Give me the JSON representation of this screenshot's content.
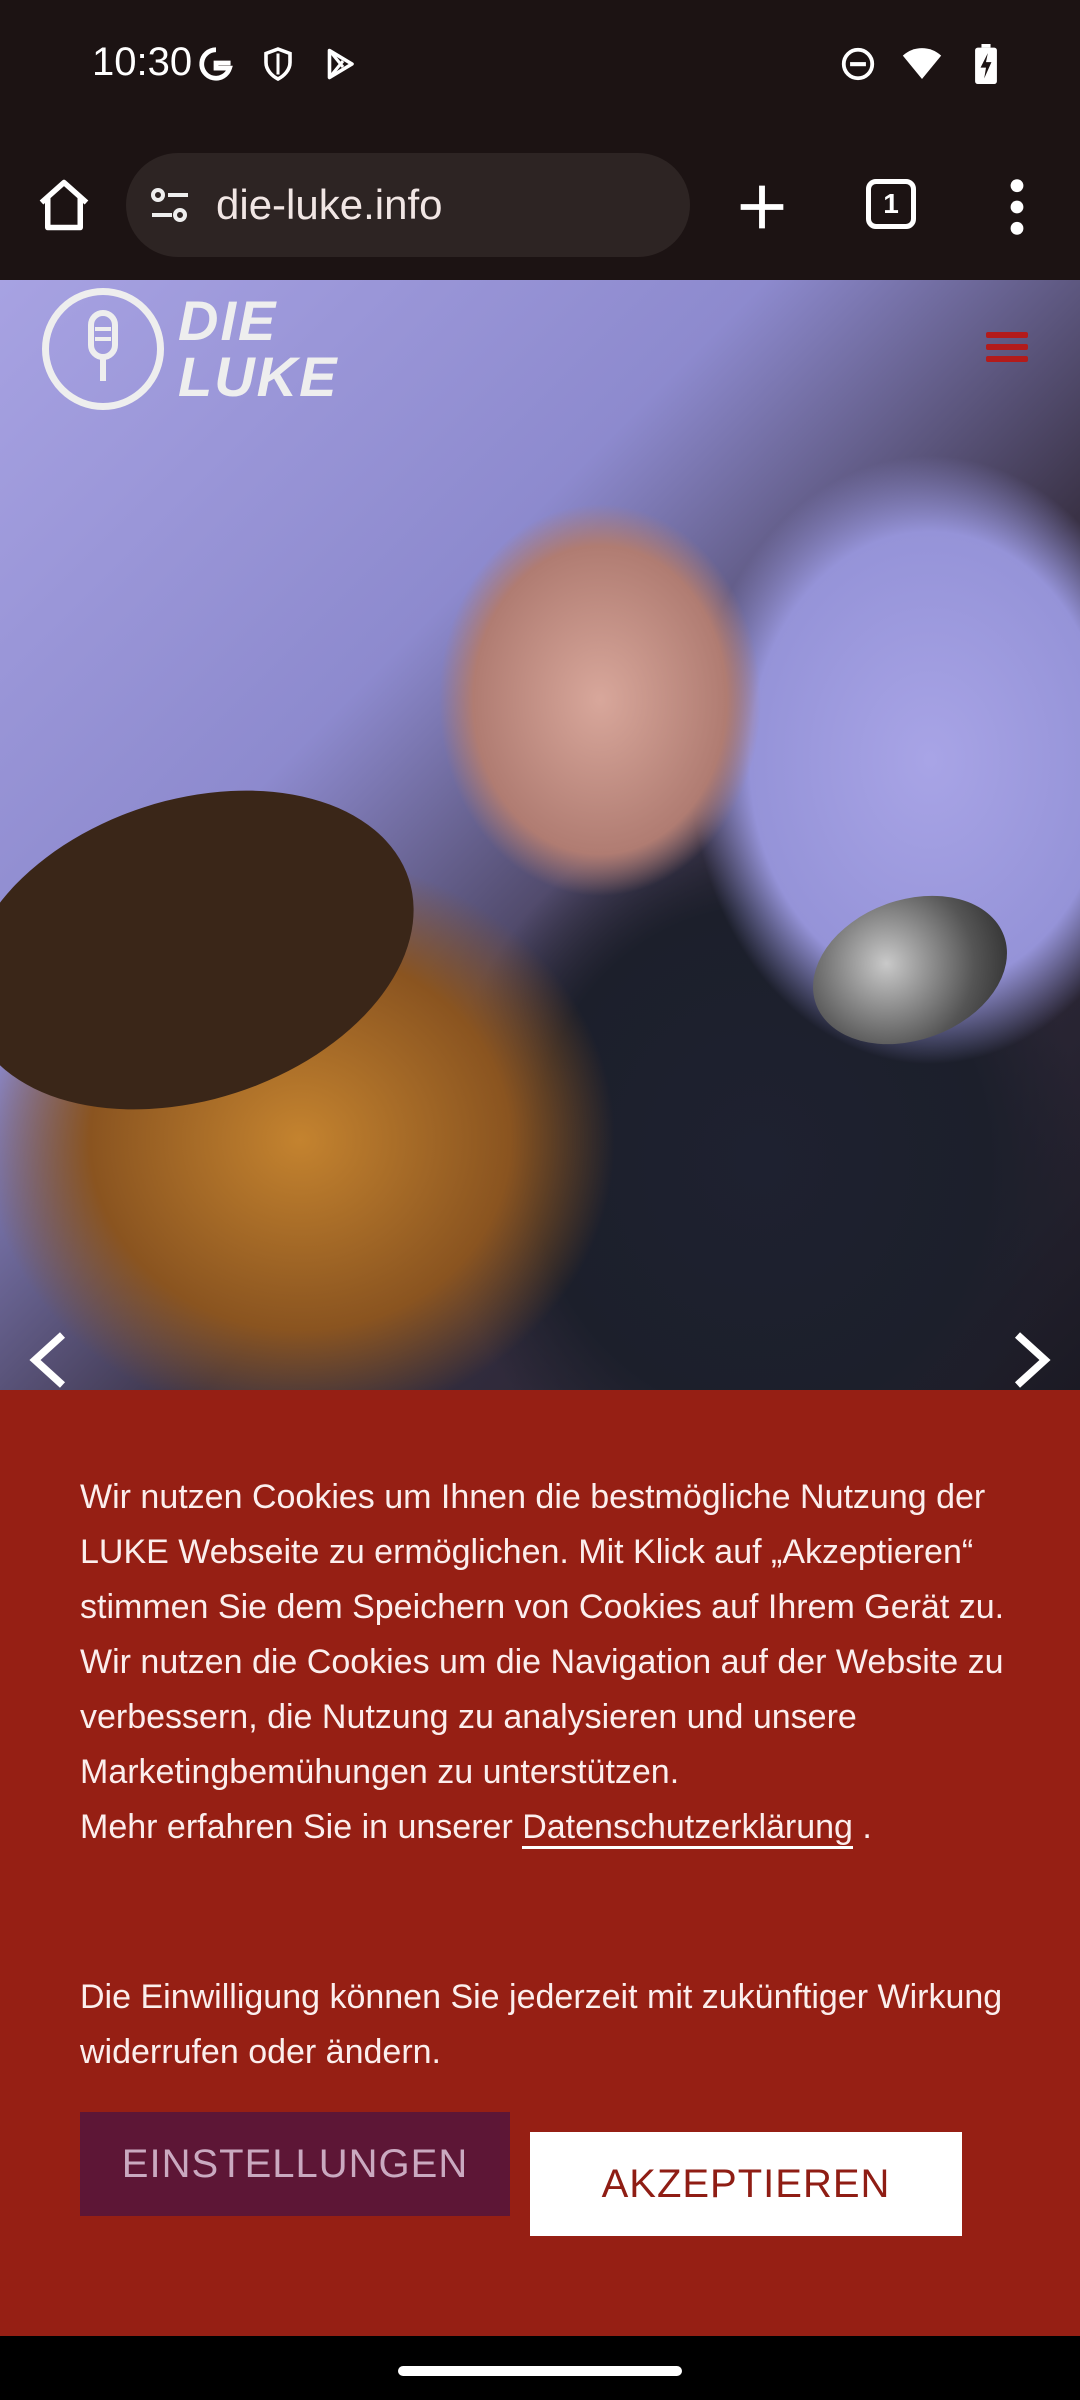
{
  "status_bar": {
    "time": "10:30",
    "left_icons": [
      "google-g-icon",
      "shield-icon",
      "play-store-icon"
    ],
    "right_icons": [
      "do-not-disturb-icon",
      "wifi-icon",
      "battery-charging-icon"
    ]
  },
  "browser": {
    "url": "die-luke.info",
    "tab_count": "1"
  },
  "site": {
    "logo_line1": "DIE",
    "logo_line2": "LUKE"
  },
  "cookie": {
    "paragraph1": "Wir nutzen Cookies um Ihnen die bestmögliche Nutzung der LUKE Webseite zu ermöglichen. Mit Klick auf „Akzeptieren“ stimmen Sie dem Speichern von Cookies auf Ihrem Gerät zu.",
    "paragraph2": "Wir nutzen die Cookies um die Navigation auf der Website zu verbessern, die Nutzung zu analysieren und unsere Marketingbemühungen zu unterstützen.",
    "more_prefix": "Mehr erfahren Sie in unserer ",
    "privacy_link": "Datenschutzerklärung",
    "more_suffix": " .",
    "paragraph3": "Die Einwilligung können Sie jederzeit mit zukünftiger Wirkung widerrufen oder ändern.",
    "settings_button": "EINSTELLUNGEN",
    "accept_button": "AKZEPTIEREN"
  },
  "colors": {
    "banner": "#961f14",
    "settings_button": "#5d1636",
    "menu_accent": "#b31b1b"
  }
}
